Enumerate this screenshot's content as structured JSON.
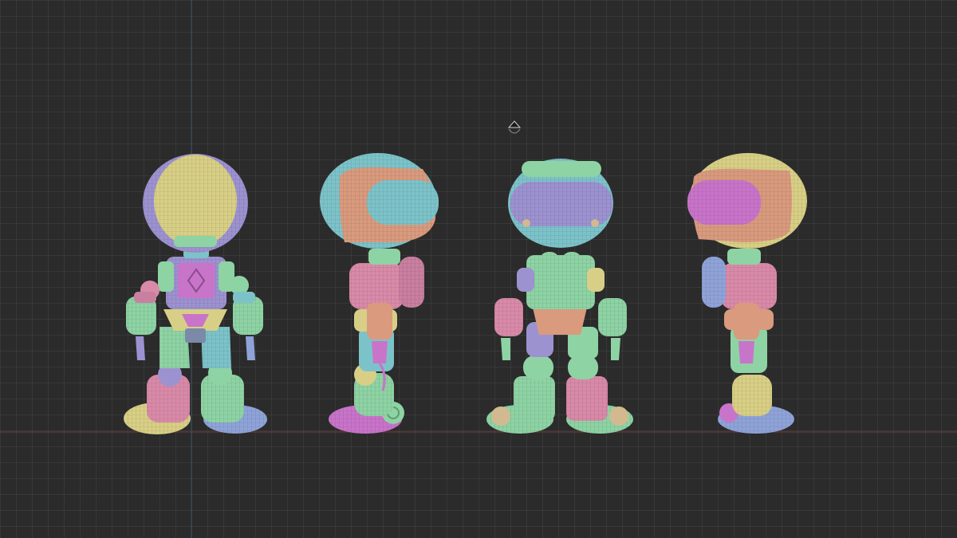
{
  "viewport": {
    "background": "#2b2b2b",
    "grid_line_color": "#3a3a3a",
    "floor_axis_color": "#7a3b3b",
    "vertical_axis_color": "#3d4f63"
  },
  "palette": {
    "yellow": "#d8cf86",
    "lavender": "#9d92d0",
    "mint": "#8ed3a4",
    "pink": "#d98aa8",
    "salmon": "#d99a7e",
    "teal": "#7cc3c9",
    "blue": "#8fa3d8",
    "rose": "#c97fa0",
    "magenta": "#c874c9",
    "sand": "#d3b98f"
  },
  "views": [
    {
      "view": "front",
      "helmet_icon": "robot-front-icon"
    },
    {
      "view": "side-left",
      "helmet_icon": "robot-side-left-icon"
    },
    {
      "view": "back",
      "helmet_icon": "robot-back-icon"
    },
    {
      "view": "side-right",
      "helmet_icon": "robot-side-right-icon"
    }
  ],
  "navigation_gizmo": {
    "icon": "view-cube-icon"
  }
}
